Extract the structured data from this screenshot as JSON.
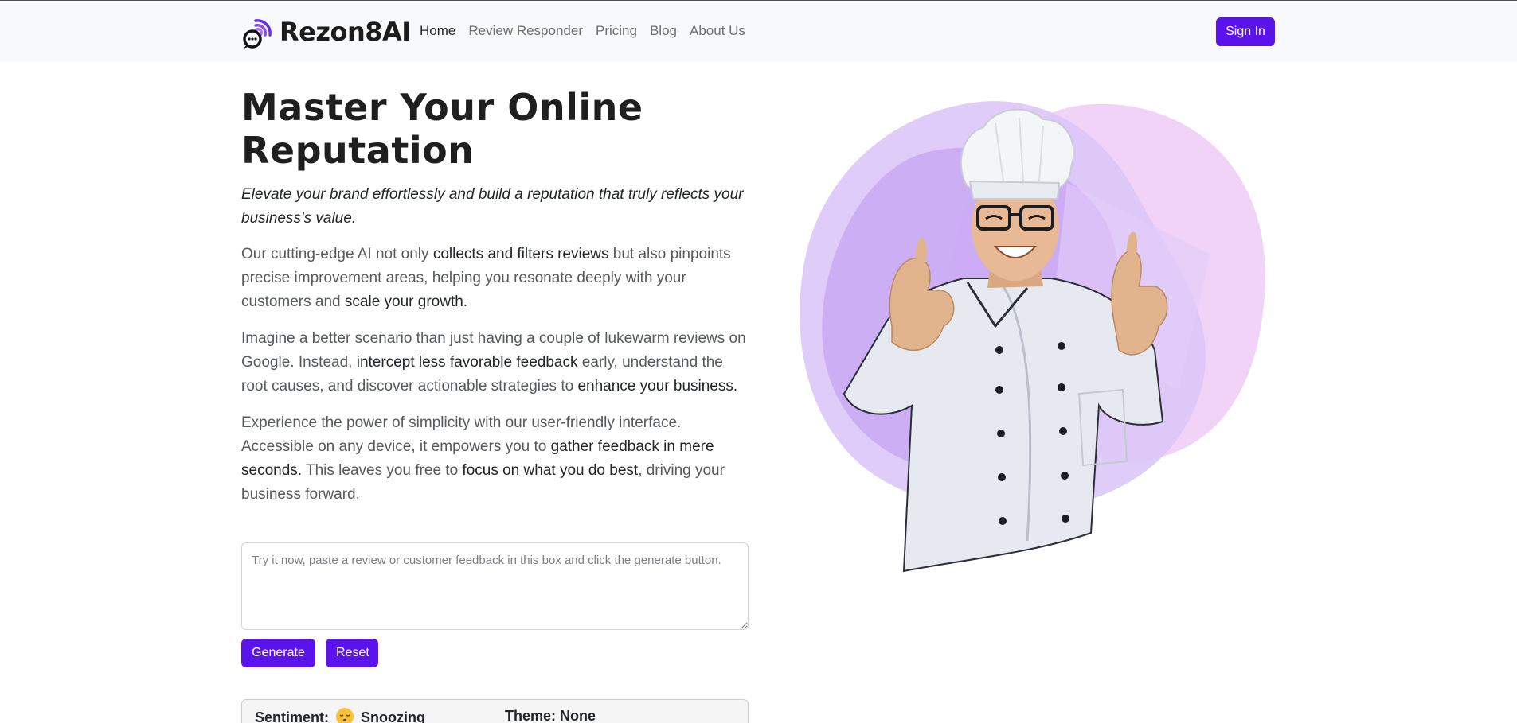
{
  "header": {
    "brand_name": "Rezon8AI",
    "nav": [
      {
        "label": "Home",
        "active": true
      },
      {
        "label": "Review Responder",
        "active": false
      },
      {
        "label": "Pricing",
        "active": false
      },
      {
        "label": "Blog",
        "active": false
      },
      {
        "label": "About Us",
        "active": false
      }
    ],
    "sign_in_label": "Sign In"
  },
  "hero": {
    "title_line1": "Master Your Online",
    "title_line2": "Reputation",
    "subtitle": "Elevate your brand effortlessly and build a reputation that truly reflects your business's value.",
    "p1": {
      "a": "Our cutting-edge AI not only ",
      "b": "collects and filters reviews",
      "c": " but also pinpoints precise improvement areas, helping you resonate deeply with your customers and ",
      "d": "scale your growth."
    },
    "p2": {
      "a": "Imagine a better scenario than just having a couple of lukewarm reviews on Google. Instead, ",
      "b": "intercept less favorable feedback",
      "c": " early, understand the root causes, and discover actionable strategies to ",
      "d": "enhance your business."
    },
    "p3": {
      "a": "Experience the power of simplicity with our user-friendly interface. Accessible on any device, it empowers you to ",
      "b": "gather feedback in mere seconds.",
      "c": " This leaves you free to ",
      "d": "focus on what you do best",
      "e": ", driving your business forward."
    }
  },
  "demo": {
    "input_value": "",
    "input_placeholder": "Try it now, paste a review or customer feedback in this box and click the generate button.",
    "generate_label": "Generate",
    "reset_label": "Reset",
    "sentiment_label": "Sentiment:",
    "sentiment_value": "Snoozing",
    "sentiment_icon": "sleeping-face-emoji",
    "theme_label": "Theme:",
    "theme_value": "None"
  },
  "colors": {
    "accent": "#5b13ec",
    "navbar_bg": "#f8f9fa",
    "blob_purple": "#c9a8f5",
    "blob_pink": "#f0d3f7"
  }
}
